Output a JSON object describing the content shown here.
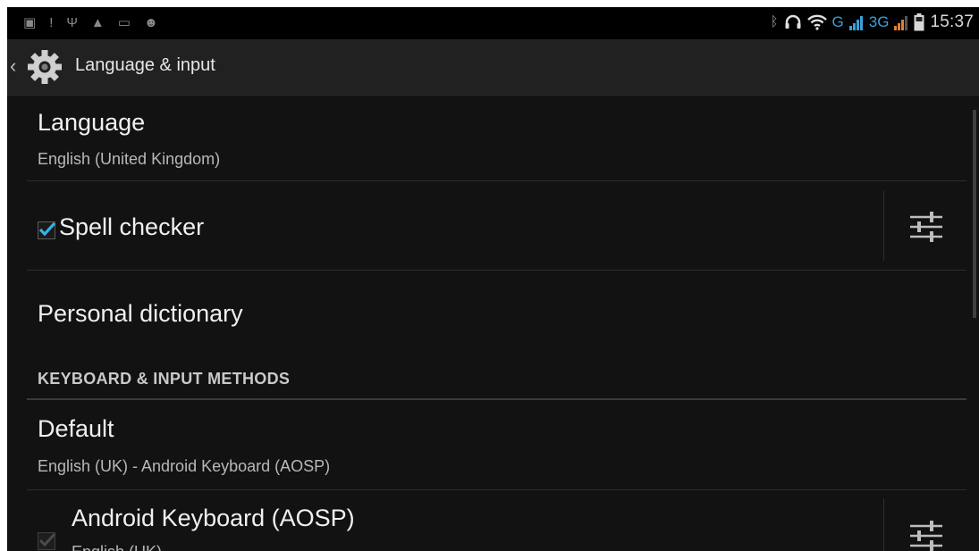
{
  "status_bar": {
    "time": "15:37",
    "network_g": "G",
    "network_3g": "3G",
    "left_icons": [
      "message-icon",
      "alert-icon",
      "usb-icon",
      "lock-icon",
      "gallery-icon",
      "android-icon"
    ],
    "right_icons": [
      "bluetooth-icon",
      "headset-icon",
      "wifi-icon",
      "signal-icon",
      "battery-icon"
    ]
  },
  "action_bar": {
    "title": "Language & input"
  },
  "items": {
    "language": {
      "title": "Language",
      "summary": "English (United Kingdom)"
    },
    "spell_checker": {
      "title": "Spell checker",
      "checked": true
    },
    "personal_dictionary": {
      "title": "Personal dictionary"
    },
    "section_header": "KEYBOARD & INPUT METHODS",
    "default": {
      "title": "Default",
      "summary": "English (UK) - Android Keyboard (AOSP)"
    },
    "android_keyboard": {
      "title": "Android Keyboard (AOSP)",
      "summary": "English (UK)",
      "checked": true
    }
  },
  "colors": {
    "accent": "#33b5e5",
    "background": "#121212",
    "action_bar": "#212121"
  }
}
